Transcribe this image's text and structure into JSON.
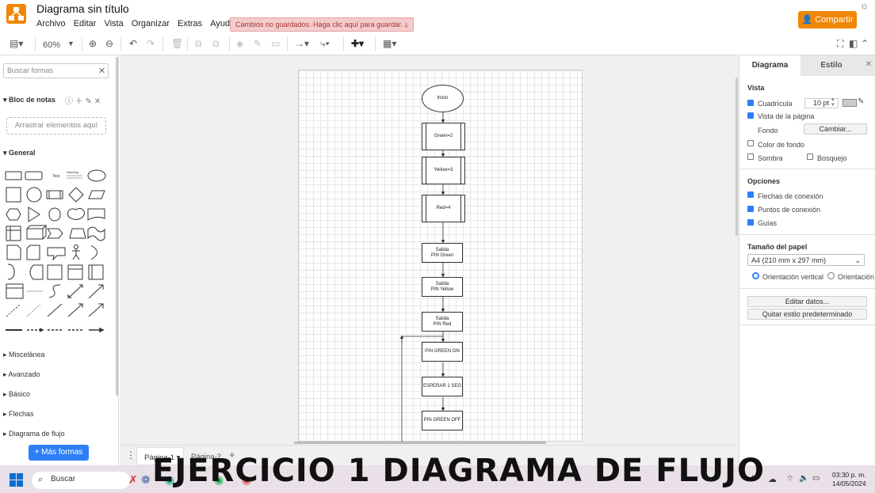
{
  "header": {
    "title": "Diagrama sin título",
    "menu": [
      "Archivo",
      "Editar",
      "Vista",
      "Organizar",
      "Extras",
      "Ayuda"
    ],
    "unsaved": "Cambios no guardados. Haga clic aquí para guardar.",
    "share": "Compartir"
  },
  "toolbar": {
    "zoom": "60%"
  },
  "sidebar": {
    "search_placeholder": "Buscar formas",
    "notepad": "Bloc de notas",
    "drop_hint": "Arrastrar elementos aquí",
    "general": "General",
    "sections": [
      "Miscelánea",
      "Avanzado",
      "Básico",
      "Flechas",
      "Diagrama de flujo"
    ],
    "more_shapes": "+ Más formas",
    "text_shape": "Text",
    "heading_shape": "Heading"
  },
  "flowchart": {
    "nodes": [
      "Inicio",
      "Green=2",
      "Yellow=3",
      "Red=4",
      "Salida\nPIN Green",
      "Salida\nPIN Yellow",
      "Salida\nPIN Red",
      "PIN GREEN ON",
      "ESPERAR 1 SEG",
      "PIN GREEN OFF"
    ]
  },
  "right_panel": {
    "tab_diagram": "Diagrama",
    "tab_style": "Estilo",
    "vista": "Vista",
    "grid": "Cuadrícula",
    "grid_size": "10 pt",
    "page_view": "Vista de la página",
    "background": "Fondo",
    "change": "Cambiar...",
    "bg_color": "Color de fondo",
    "shadow": "Sombra",
    "sketch": "Bosquejo",
    "options": "Opciones",
    "connection_arrows": "Flechas de conexión",
    "connection_points": "Puntos de conexión",
    "guides": "Guías",
    "paper_size": "Tamaño del papel",
    "paper_value": "A4 (210 mm x 297 mm)",
    "portrait": "Orientación vertical",
    "landscape": "Orientación",
    "edit_data": "Editar datos...",
    "clear_style": "Quitar estilo predeterminado"
  },
  "pages": {
    "page1": "Página-1",
    "page2": "Página-2"
  },
  "taskbar": {
    "search": "Buscar",
    "time": "03:30 p. m.",
    "date": "14/05/2024"
  },
  "overlay_title": "EJERCICIO 1 DIAGRAMA DE FLUJO"
}
